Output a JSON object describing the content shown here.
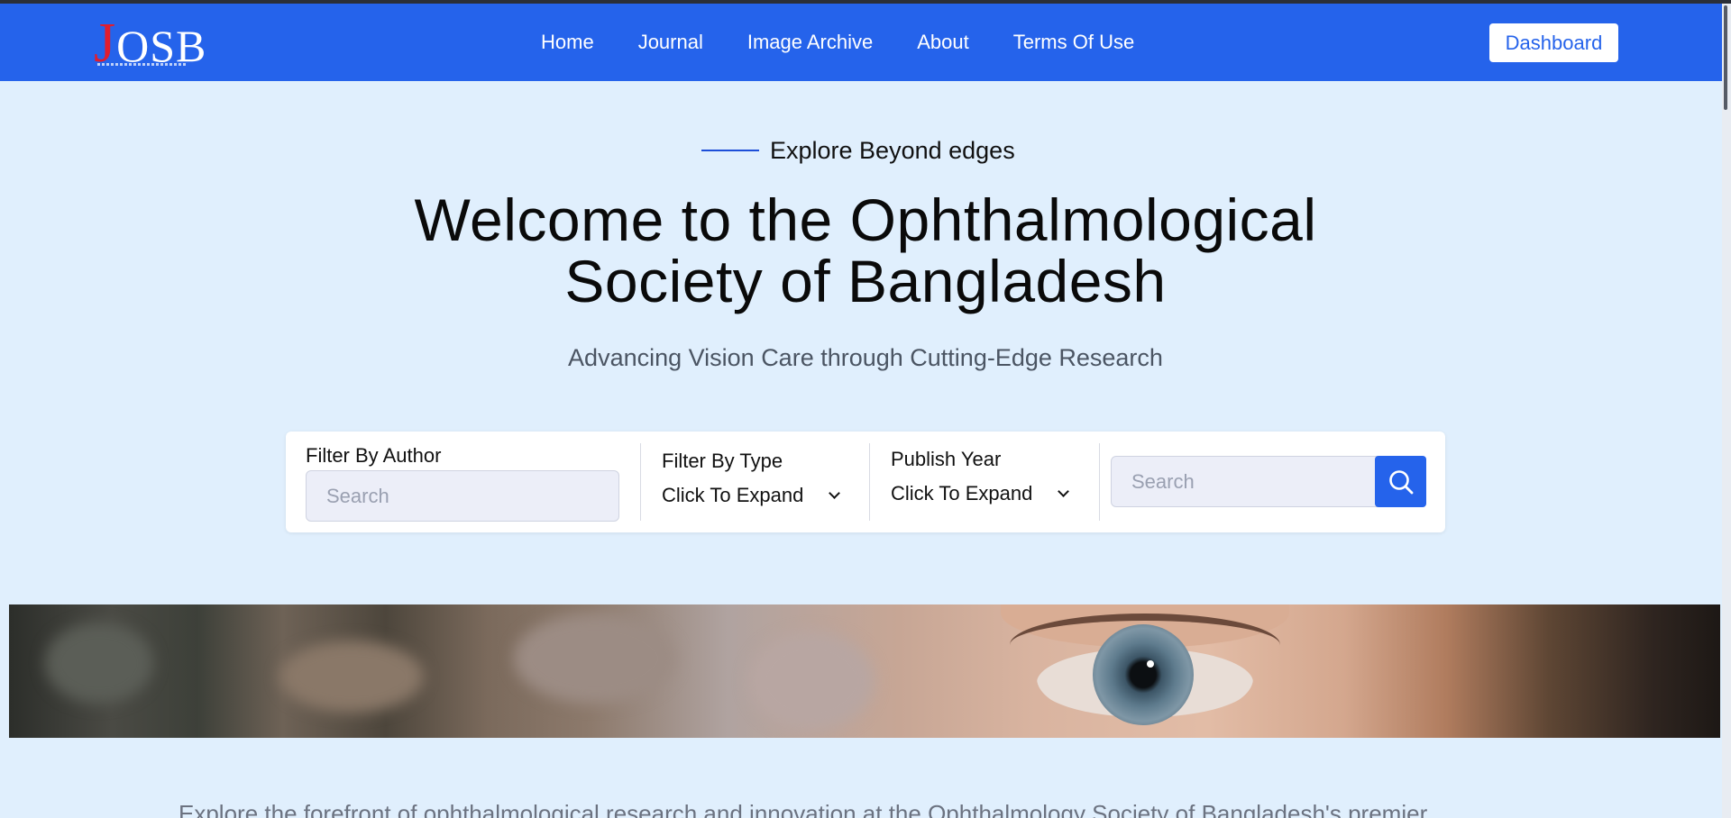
{
  "header": {
    "logo": "JOSB",
    "nav": [
      "Home",
      "Journal",
      "Image Archive",
      "About",
      "Terms Of Use"
    ],
    "dashboard_label": "Dashboard"
  },
  "hero": {
    "eyebrow": "Explore Beyond edges",
    "title_line1": "Welcome to the Ophthalmological",
    "title_line2": "Society of Bangladesh",
    "subtitle": "Advancing Vision Care through Cutting-Edge Research"
  },
  "filters": {
    "author_label": "Filter By Author",
    "author_placeholder": "Search",
    "type_label": "Filter By Type",
    "type_value": "Click To Expand",
    "year_label": "Publish Year",
    "year_value": "Click To Expand",
    "search_placeholder": "Search",
    "search_icon": "search-icon"
  },
  "intro": {
    "text": "Explore the forefront of ophthalmological research and innovation at the Ophthalmology Society of Bangladesh's premier"
  },
  "colors": {
    "primary": "#2563eb",
    "background": "#e0effd"
  }
}
